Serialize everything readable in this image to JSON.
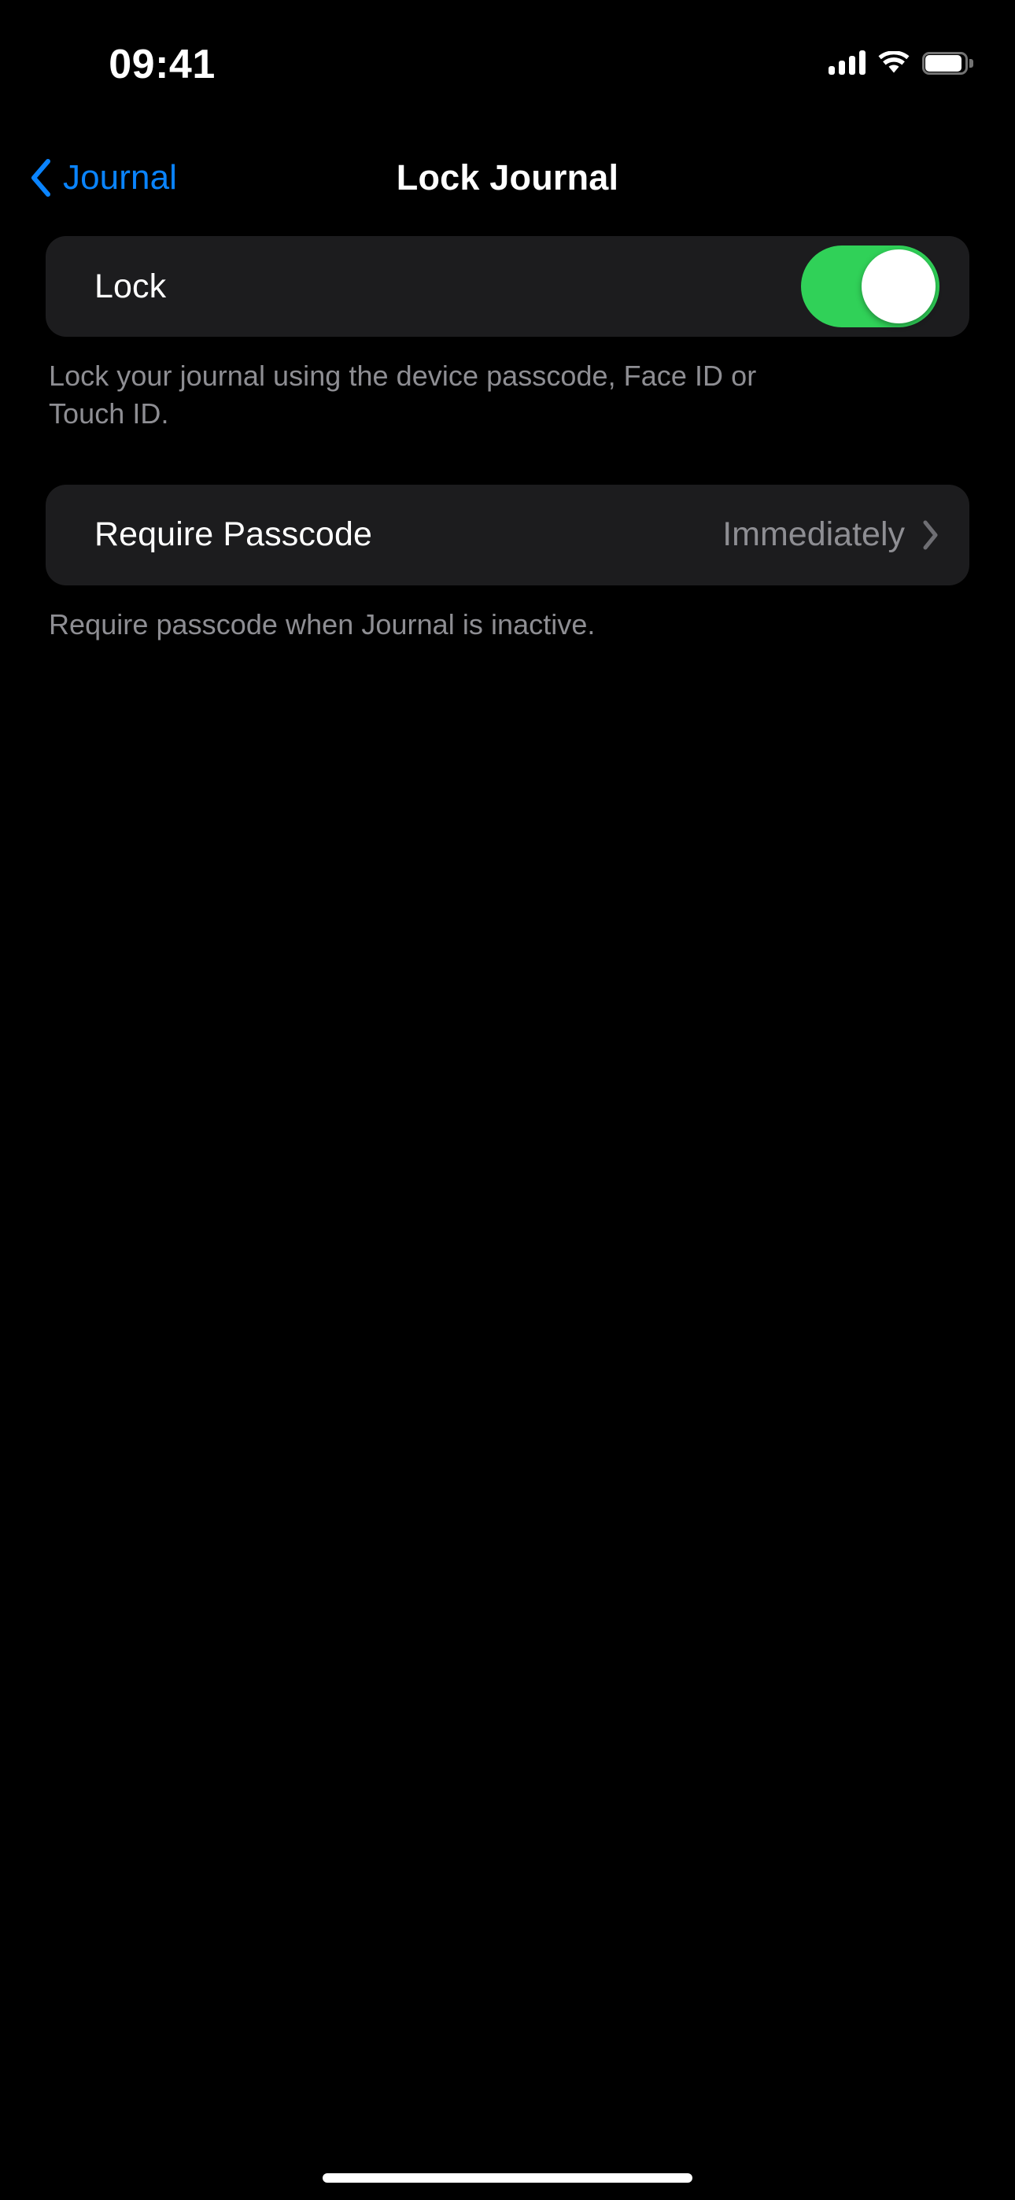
{
  "status_bar": {
    "time": "09:41",
    "cellular_icon": "signal-bars-icon",
    "wifi_icon": "wifi-icon",
    "battery_icon": "battery-icon"
  },
  "nav_bar": {
    "back_icon": "chevron-left-icon",
    "back_label": "Journal",
    "title": "Lock Journal"
  },
  "sections": [
    {
      "rows": [
        {
          "label": "Lock",
          "control": "toggle",
          "toggle_on": true
        }
      ],
      "footnote": "Lock your journal using the device passcode, Face ID or Touch ID."
    },
    {
      "rows": [
        {
          "label": "Require Passcode",
          "control": "disclosure",
          "value": "Immediately",
          "chevron_icon": "chevron-right-icon"
        }
      ],
      "footnote": "Require passcode when Journal is inactive."
    }
  ],
  "home_indicator": "home-indicator",
  "colors": {
    "background": "#000000",
    "card": "#1C1C1E",
    "accent_blue": "#0A84FF",
    "toggle_green": "#30D158",
    "secondary_text": "#8E8E93",
    "primary_text": "#FFFFFF"
  }
}
